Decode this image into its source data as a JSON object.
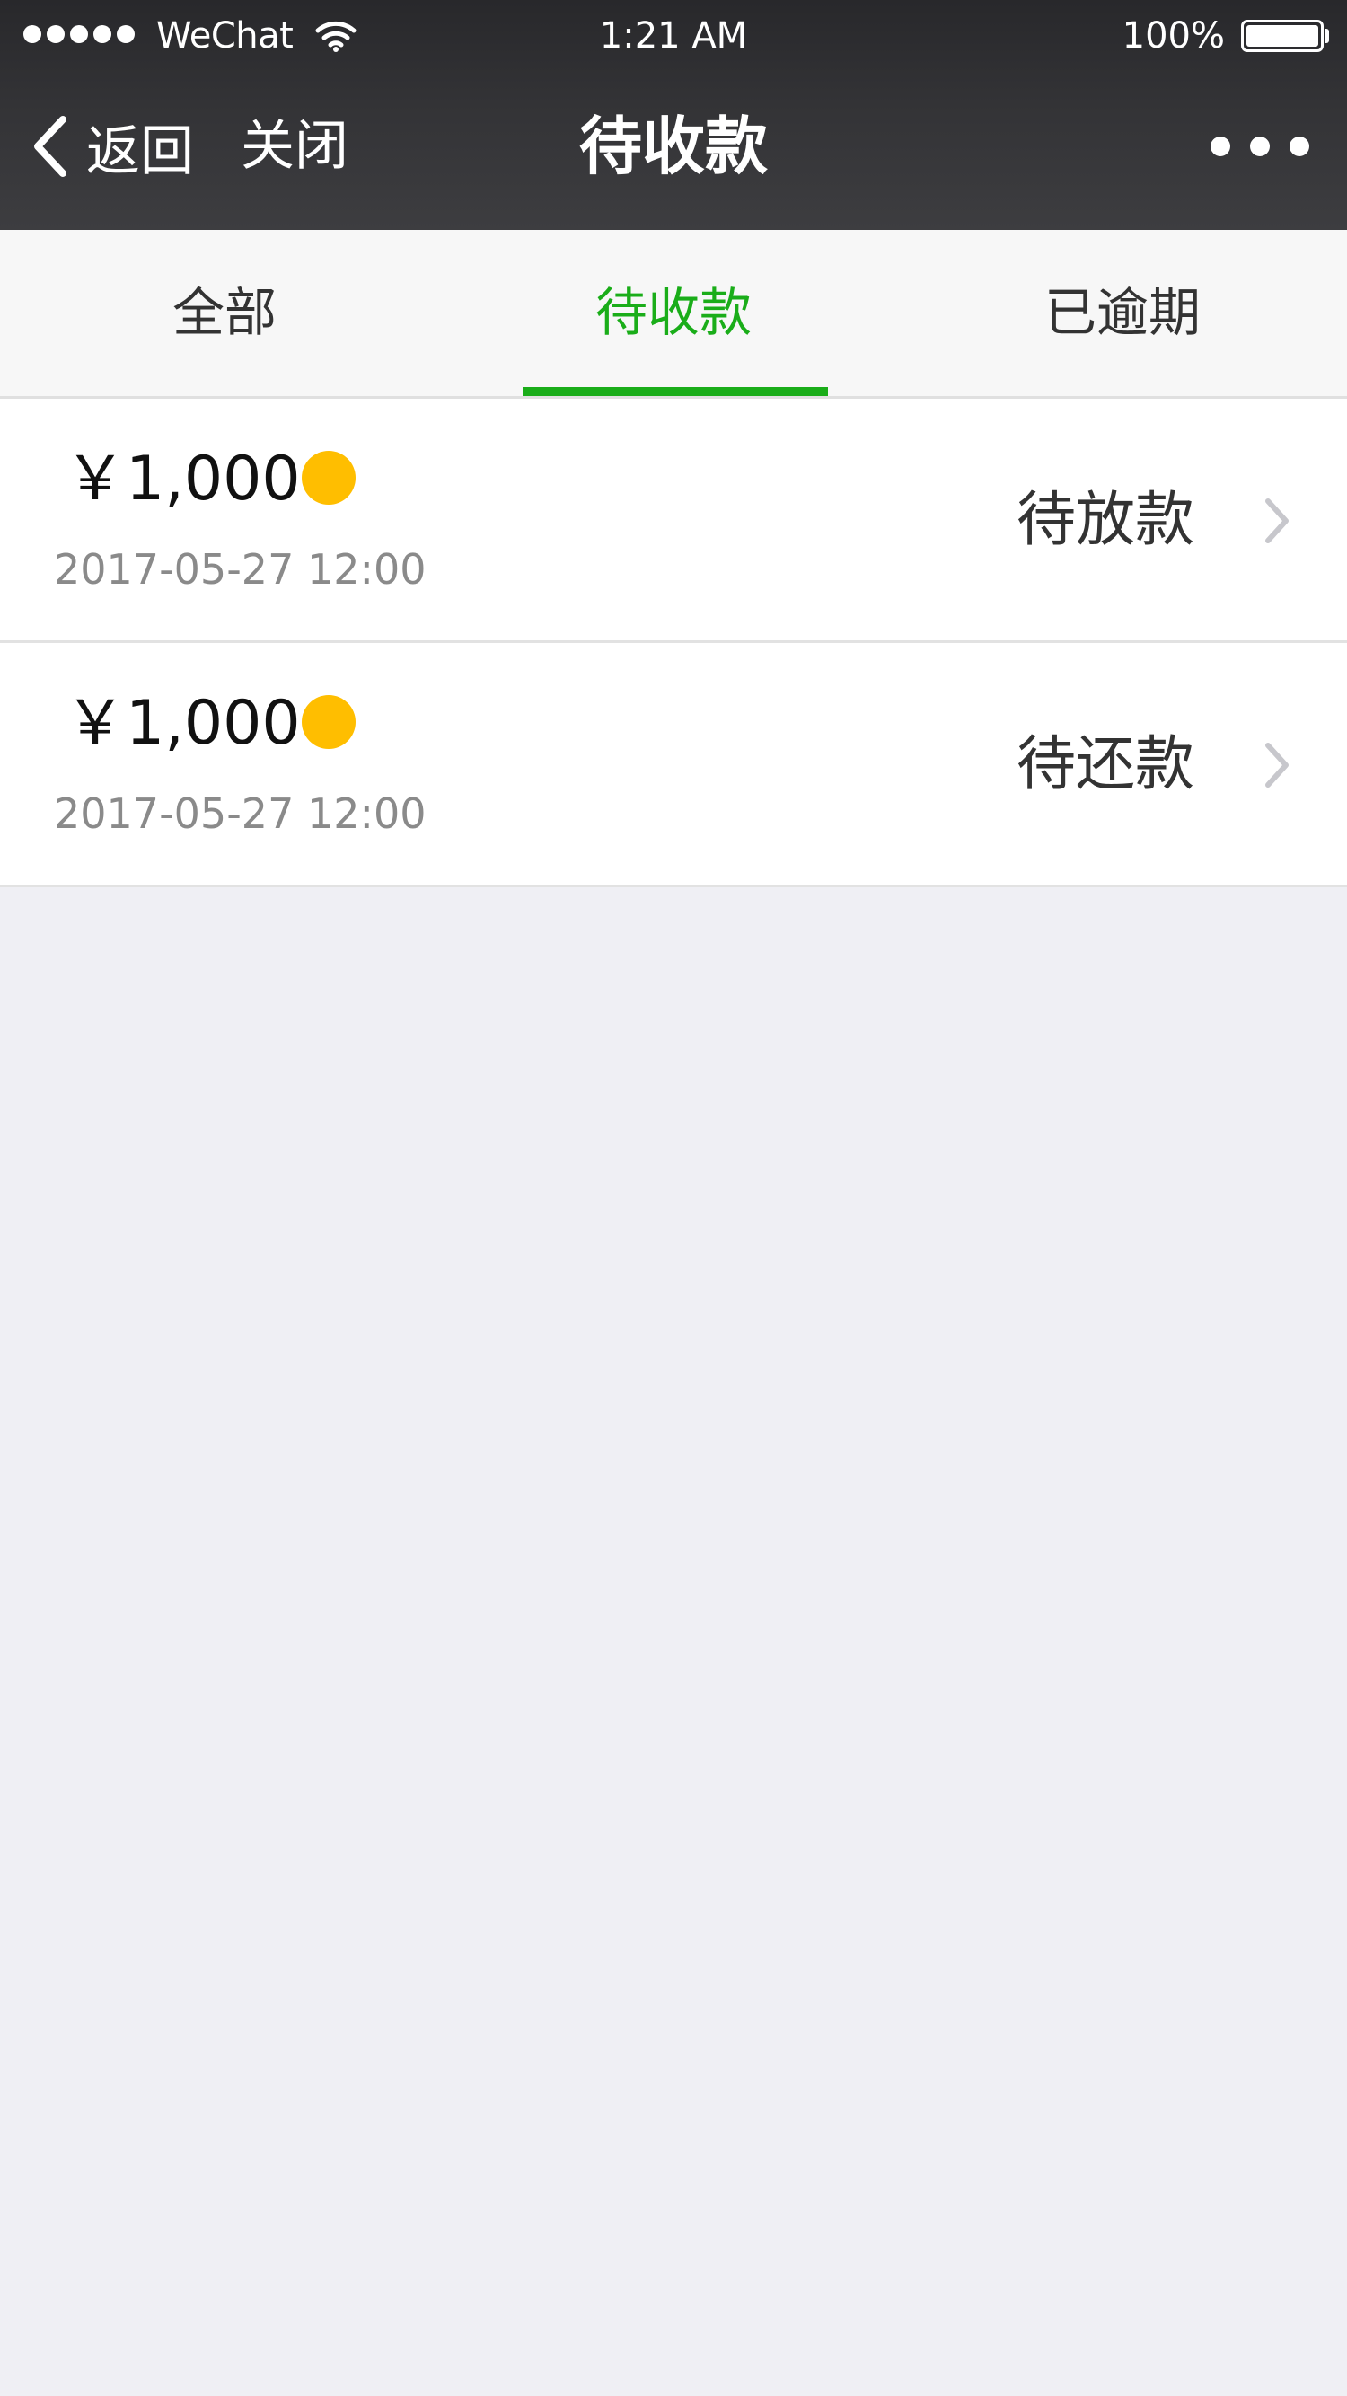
{
  "status_bar": {
    "carrier": "WeChat",
    "time": "1:21 AM",
    "battery_percent": "100%"
  },
  "nav": {
    "back_label": "返回",
    "close_label": "关闭",
    "title": "待收款"
  },
  "tabs": [
    {
      "label": "全部",
      "active": false
    },
    {
      "label": "待收款",
      "active": true
    },
    {
      "label": "已逾期",
      "active": false
    }
  ],
  "items": [
    {
      "amount": "￥1,000",
      "date": "2017-05-27 12:00",
      "status": "待放款"
    },
    {
      "amount": "￥1,000",
      "date": "2017-05-27 12:00",
      "status": "待还款"
    }
  ],
  "colors": {
    "accent": "#1aad19",
    "status_dot": "#ffbe00",
    "header_bg": "#333336",
    "page_bg": "#efeff4"
  },
  "icons": {
    "back": "chevron-left-icon",
    "more": "more-dots-icon",
    "row_arrow": "chevron-right-icon",
    "wifi": "wifi-icon",
    "battery": "battery-icon"
  }
}
